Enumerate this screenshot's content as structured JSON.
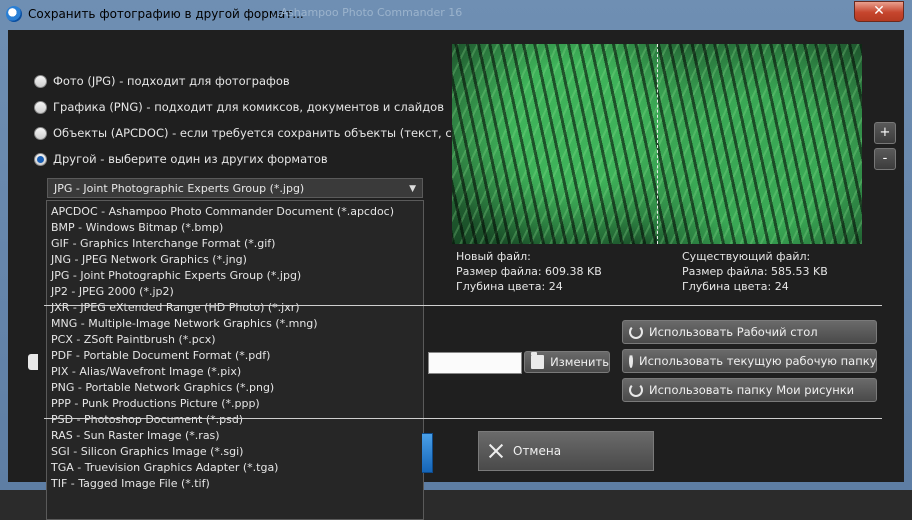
{
  "window": {
    "title": "Сохранить фотографию в другой формат...",
    "behind_title": "...Ashampoo Photo Commander 16"
  },
  "colors": {
    "accent": "#1a5fb4",
    "background": "#1f1f1f",
    "close": "#c6452d"
  },
  "format_options": [
    {
      "label": "Фото (JPG) - подходит для фотографов",
      "selected": false
    },
    {
      "label": "Графика (PNG) - подходит для комиксов, документов и слайдов",
      "selected": false
    },
    {
      "label": "Объекты (APCDOC) - если требуется сохранить объекты (текст, стрелк",
      "selected": false
    },
    {
      "label": "Другой - выберите один из других форматов",
      "selected": true
    }
  ],
  "format_select": {
    "value": "JPG - Joint Photographic Experts Group (*.jpg)",
    "options": [
      "APCDOC - Ashampoo Photo Commander Document (*.apcdoc)",
      "BMP - Windows Bitmap (*.bmp)",
      "GIF - Graphics Interchange Format (*.gif)",
      "JNG - JPEG Network Graphics (*.jng)",
      "JPG - Joint Photographic Experts Group (*.jpg)",
      "JP2 - JPEG 2000 (*.jp2)",
      "JXR - JPEG eXtended Range (HD Photo) (*.jxr)",
      "MNG - Multiple-Image Network Graphics (*.mng)",
      "PCX - ZSoft Paintbrush (*.pcx)",
      "PDF - Portable Document Format (*.pdf)",
      "PIX - Alias/Wavefront Image (*.pix)",
      "PNG - Portable Network Graphics (*.png)",
      "PPP - Punk Productions Picture (*.ppp)",
      "PSD - Photoshop Document (*.psd)",
      "RAS - Sun Raster Image (*.ras)",
      "SGI - Silicon Graphics Image (*.sgi)",
      "TGA - Truevision Graphics Adapter (*.tga)",
      "TIF - Tagged Image File (*.tif)"
    ]
  },
  "zoom": {
    "plus": "+",
    "minus": "-"
  },
  "new_file": {
    "heading": "Новый файл:",
    "size": "Размер файла: 609.38 KB",
    "depth": "Глубина цвета: 24"
  },
  "existing_file": {
    "heading": "Существующий файл:",
    "size": "Размер файла: 585.53 KB",
    "depth": "Глубина цвета: 24"
  },
  "buttons": {
    "change": "Изменить",
    "use_desktop": "Использовать Рабочий стол",
    "use_current_folder": "Использовать текущую рабочую папку",
    "use_my_pictures": "Использовать папку Мои рисунки",
    "cancel": "Отмена",
    "close": "✕"
  }
}
